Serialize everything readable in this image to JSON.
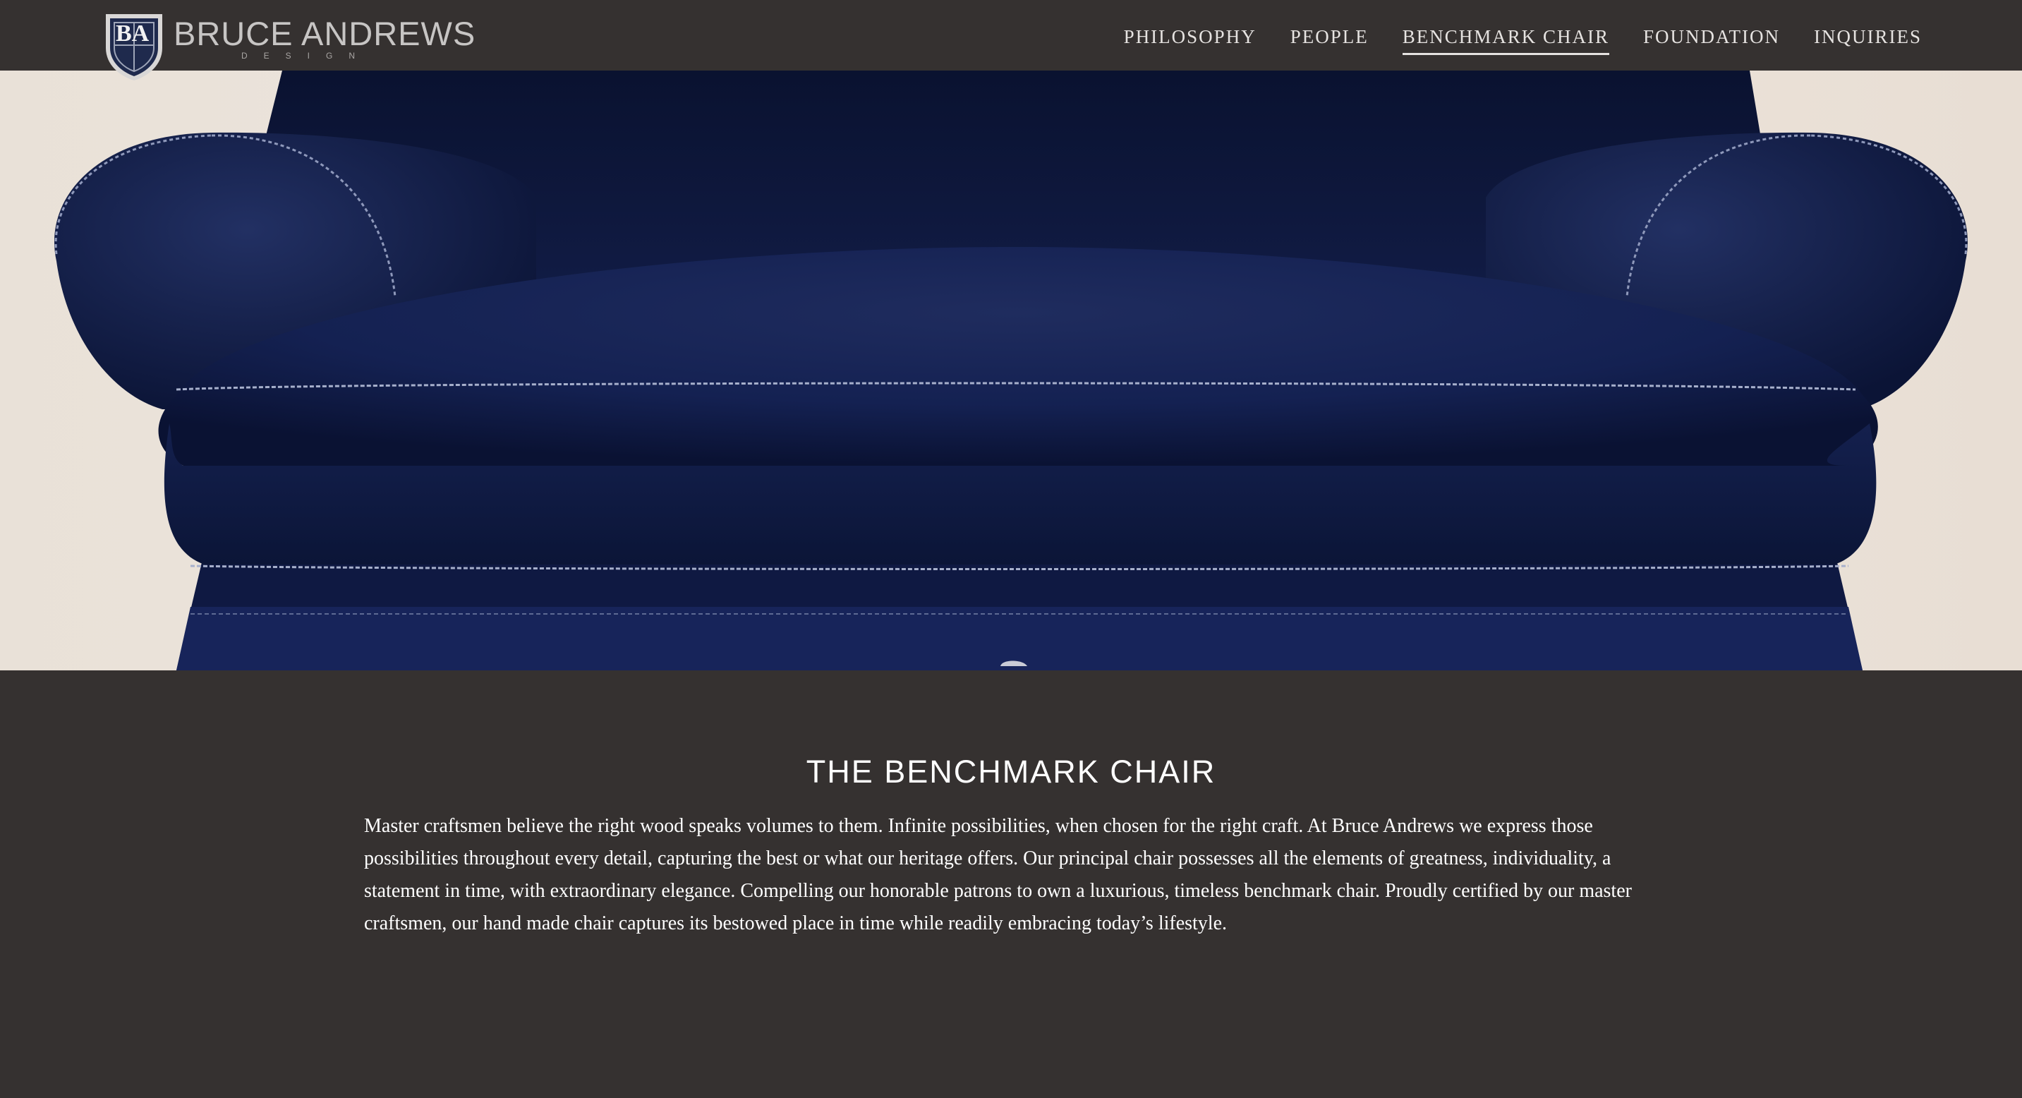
{
  "brand": {
    "monogram": "BA",
    "name": "BRUCE ANDREWS",
    "tagline": "DESIGN"
  },
  "nav": {
    "items": [
      {
        "label": "PHILOSOPHY",
        "active": false
      },
      {
        "label": "PEOPLE",
        "active": false
      },
      {
        "label": "BENCHMARK CHAIR",
        "active": true
      },
      {
        "label": "FOUNDATION",
        "active": false
      },
      {
        "label": "INQUIRIES",
        "active": false
      }
    ]
  },
  "hero": {
    "subject": "blue velvet benchmark chair",
    "colors": {
      "velvet": "#0f1a3e",
      "backdrop": "#ece3da"
    }
  },
  "section": {
    "title": "THE BENCHMARK CHAIR",
    "body": "Master craftsmen believe the right wood speaks volumes to them. Infinite possibilities, when chosen for the right craft. At Bruce Andrews we express those possibilities throughout every detail, capturing the best or what our heritage offers. Our principal chair possesses all the elements of greatness, individuality, a statement in time, with extraordinary elegance. Compelling our honorable patrons to own a luxurious, timeless benchmark chair. Proudly certified by our master craftsmen, our hand made chair captures its bestowed place in time while readily embracing today’s lifestyle."
  },
  "colors": {
    "background": "#353130",
    "nav_text": "#e6e3e1",
    "body_text": "#ffffff"
  }
}
